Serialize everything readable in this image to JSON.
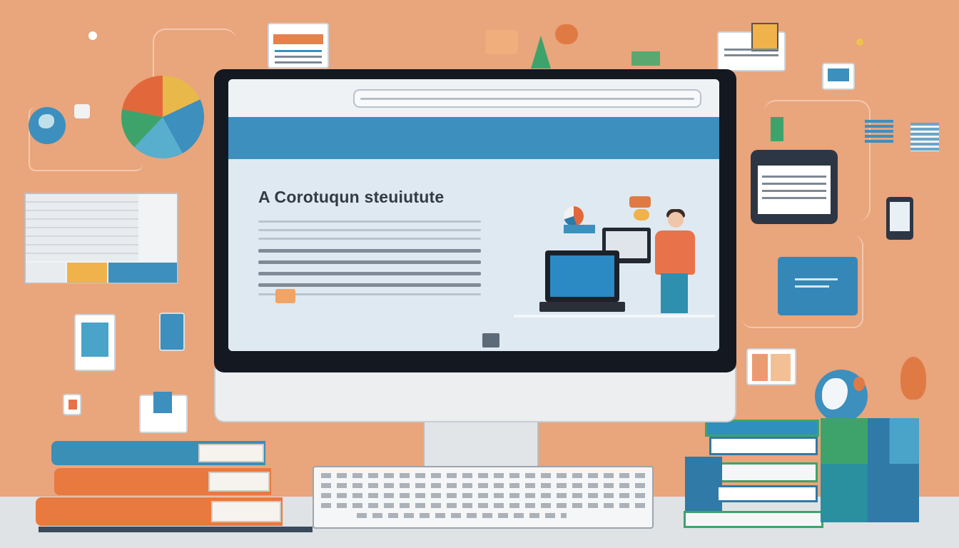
{
  "screen": {
    "headline": "A Corotuqun steuiutute"
  },
  "colors": {
    "background": "#e9a57c",
    "accent_blue": "#3d8fbd",
    "accent_orange": "#e8734a",
    "screen_bg": "#dfe9f1",
    "frame": "#141820"
  },
  "icons": [
    "pie-chart-icon",
    "globe-icon",
    "tablet-icon",
    "phone-icon",
    "document-icon",
    "book-stack-icon"
  ]
}
